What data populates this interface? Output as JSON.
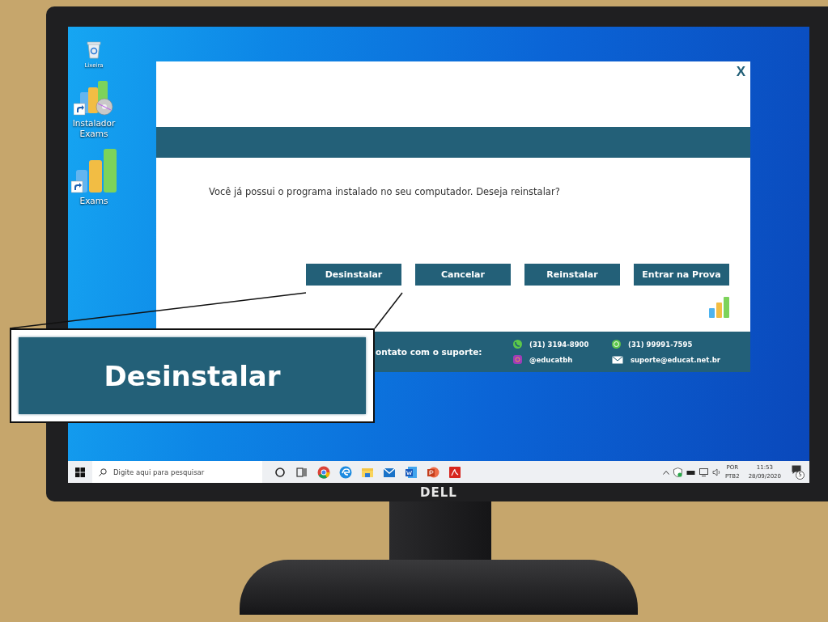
{
  "desktop_icons": [
    {
      "kind": "trash",
      "label": "Lixeira"
    },
    {
      "kind": "installer",
      "label": "Instalador Exams"
    },
    {
      "kind": "app",
      "label": "Exams"
    }
  ],
  "dialog": {
    "close": "X",
    "message": "Você já possui o programa instalado no seu computador. Deseja reinstalar?",
    "buttons": [
      "Desinstalar",
      "Cancelar",
      "Reinstalar",
      "Entrar na Prova"
    ],
    "footer": {
      "label": "ontato com o suporte:",
      "contacts": [
        {
          "kind": "phone",
          "text": "(31) 3194-8900"
        },
        {
          "kind": "whatsapp",
          "text": "(31) 99991-7595"
        },
        {
          "kind": "instagram",
          "text": "@educatbh"
        },
        {
          "kind": "email",
          "text": "suporte@educat.net.br"
        }
      ]
    }
  },
  "callout": {
    "label": "Desinstalar"
  },
  "taskbar": {
    "search_placeholder": "Digite aqui para pesquisar",
    "apps": [
      {
        "kind": "cortana"
      },
      {
        "kind": "task-view"
      },
      {
        "kind": "chrome"
      },
      {
        "kind": "edge"
      },
      {
        "kind": "folder"
      },
      {
        "kind": "mail"
      },
      {
        "kind": "word"
      },
      {
        "kind": "powerpoint"
      },
      {
        "kind": "pdf"
      }
    ],
    "language": "POR",
    "layout": "PTB2",
    "time": "11:53",
    "date": "28/09/2020",
    "notifications": "5"
  },
  "monitor": {
    "brand": "DELL"
  }
}
